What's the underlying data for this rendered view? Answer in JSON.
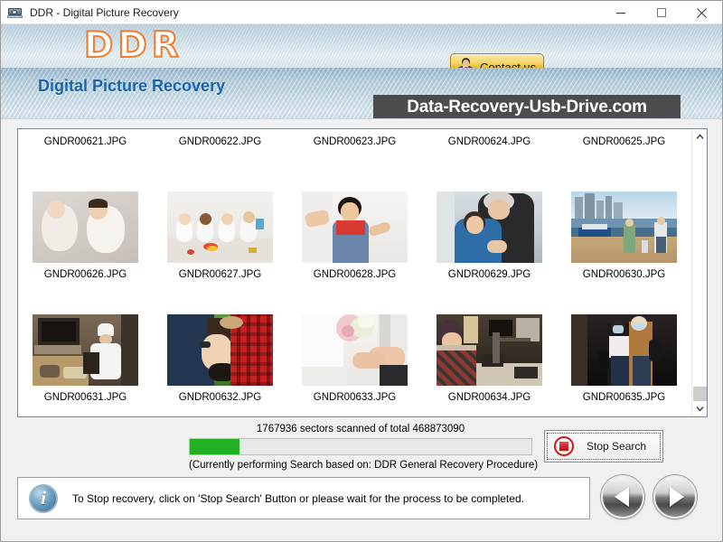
{
  "window": {
    "title": "DDR - Digital Picture Recovery",
    "app_icon": "camera-icon",
    "controls": {
      "minimize": "minimize-icon",
      "maximize": "maximize-icon",
      "close": "close-icon"
    }
  },
  "banner": {
    "logo": "DDR",
    "subtitle": "Digital Picture Recovery",
    "watermark": "Data-Recovery-Usb-Drive.com",
    "contact_button": {
      "label": "Contact us",
      "icon": "user-avatar-icon"
    }
  },
  "thumbnails": {
    "rows": [
      {
        "labels_top": [
          "GNDR00621.JPG",
          "GNDR00622.JPG",
          "GNDR00623.JPG",
          "GNDR00624.JPG",
          "GNDR00625.JPG"
        ],
        "images": [
          "babies-lying-carpet",
          "four-babies-sitting",
          "boy-peace-sign",
          "grandmother-hugging-boy",
          "family-walking-waterfront"
        ],
        "labels_bottom": [
          "GNDR00626.JPG",
          "GNDR00627.JPG",
          "GNDR00628.JPG",
          "GNDR00629.JPG",
          "GNDR00630.JPG"
        ]
      },
      {
        "images": [
          "chef-kitchen-cooking",
          "couple-lying-grass",
          "bride-bouquet-hands",
          "man-workshop-desk",
          "couple-walking-masks"
        ],
        "labels_bottom": [
          "GNDR00631.JPG",
          "GNDR00632.JPG",
          "GNDR00633.JPG",
          "GNDR00634.JPG",
          "GNDR00635.JPG"
        ]
      }
    ],
    "scrollbar": {
      "up_arrow": "chevron-up-icon",
      "down_arrow": "chevron-down-icon"
    }
  },
  "progress": {
    "sectors_text": "1767936  sectors scanned of total 468873090",
    "percent": 14.5,
    "fill_color": "#22b122",
    "procedure_text": "(Currently performing Search based on:  DDR General Recovery Procedure)"
  },
  "stop_search": {
    "label": "Stop Search",
    "icon": "stop-icon"
  },
  "info": {
    "icon": "info-icon",
    "icon_glyph": "i",
    "message": "To Stop recovery, click on 'Stop Search' Button or please wait for the process to be completed."
  },
  "navigation": {
    "prev": "previous-icon",
    "next": "next-icon"
  }
}
